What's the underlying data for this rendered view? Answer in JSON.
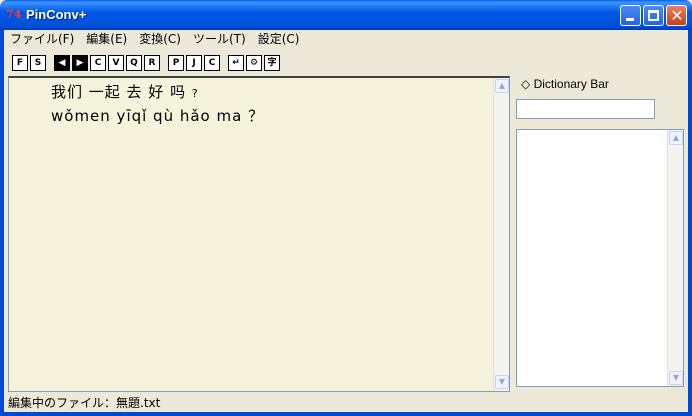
{
  "window": {
    "title": "PinConv+",
    "icon_text": "74",
    "close_glyph": "✕"
  },
  "menu": {
    "items": [
      {
        "label": "ファイル(F)"
      },
      {
        "label": "編集(E)"
      },
      {
        "label": "変換(C)"
      },
      {
        "label": "ツール(T)"
      },
      {
        "label": "設定(C)"
      }
    ]
  },
  "toolbar": {
    "groups": [
      [
        {
          "name": "open-icon",
          "glyph": "F"
        },
        {
          "name": "save-icon",
          "glyph": "S"
        }
      ],
      [
        {
          "name": "prev-icon",
          "glyph": "◀"
        },
        {
          "name": "next-icon",
          "glyph": "▶"
        },
        {
          "name": "copy-icon",
          "glyph": "C"
        },
        {
          "name": "paste-icon",
          "glyph": "V"
        },
        {
          "name": "find-icon",
          "glyph": "Q"
        },
        {
          "name": "replace-icon",
          "glyph": "R"
        }
      ],
      [
        {
          "name": "pinyin-icon",
          "glyph": "P"
        },
        {
          "name": "jump-icon",
          "glyph": "J"
        },
        {
          "name": "convert-icon",
          "glyph": "C"
        }
      ],
      [
        {
          "name": "return-icon",
          "glyph": "↵"
        },
        {
          "name": "settings-icon",
          "glyph": "⚙"
        },
        {
          "name": "char-icon",
          "glyph": "字"
        }
      ]
    ]
  },
  "editor": {
    "line1": "我们 一起 去 好 吗 ",
    "line1_mark": "?",
    "line2": "wǒmen yīqǐ qù hǎo ma ？"
  },
  "dictionary": {
    "title": "◇ Dictionary Bar",
    "query": ""
  },
  "status": {
    "text": "編集中のファイル：無題.txt"
  },
  "scroll": {
    "up": "▲",
    "down": "▼"
  }
}
